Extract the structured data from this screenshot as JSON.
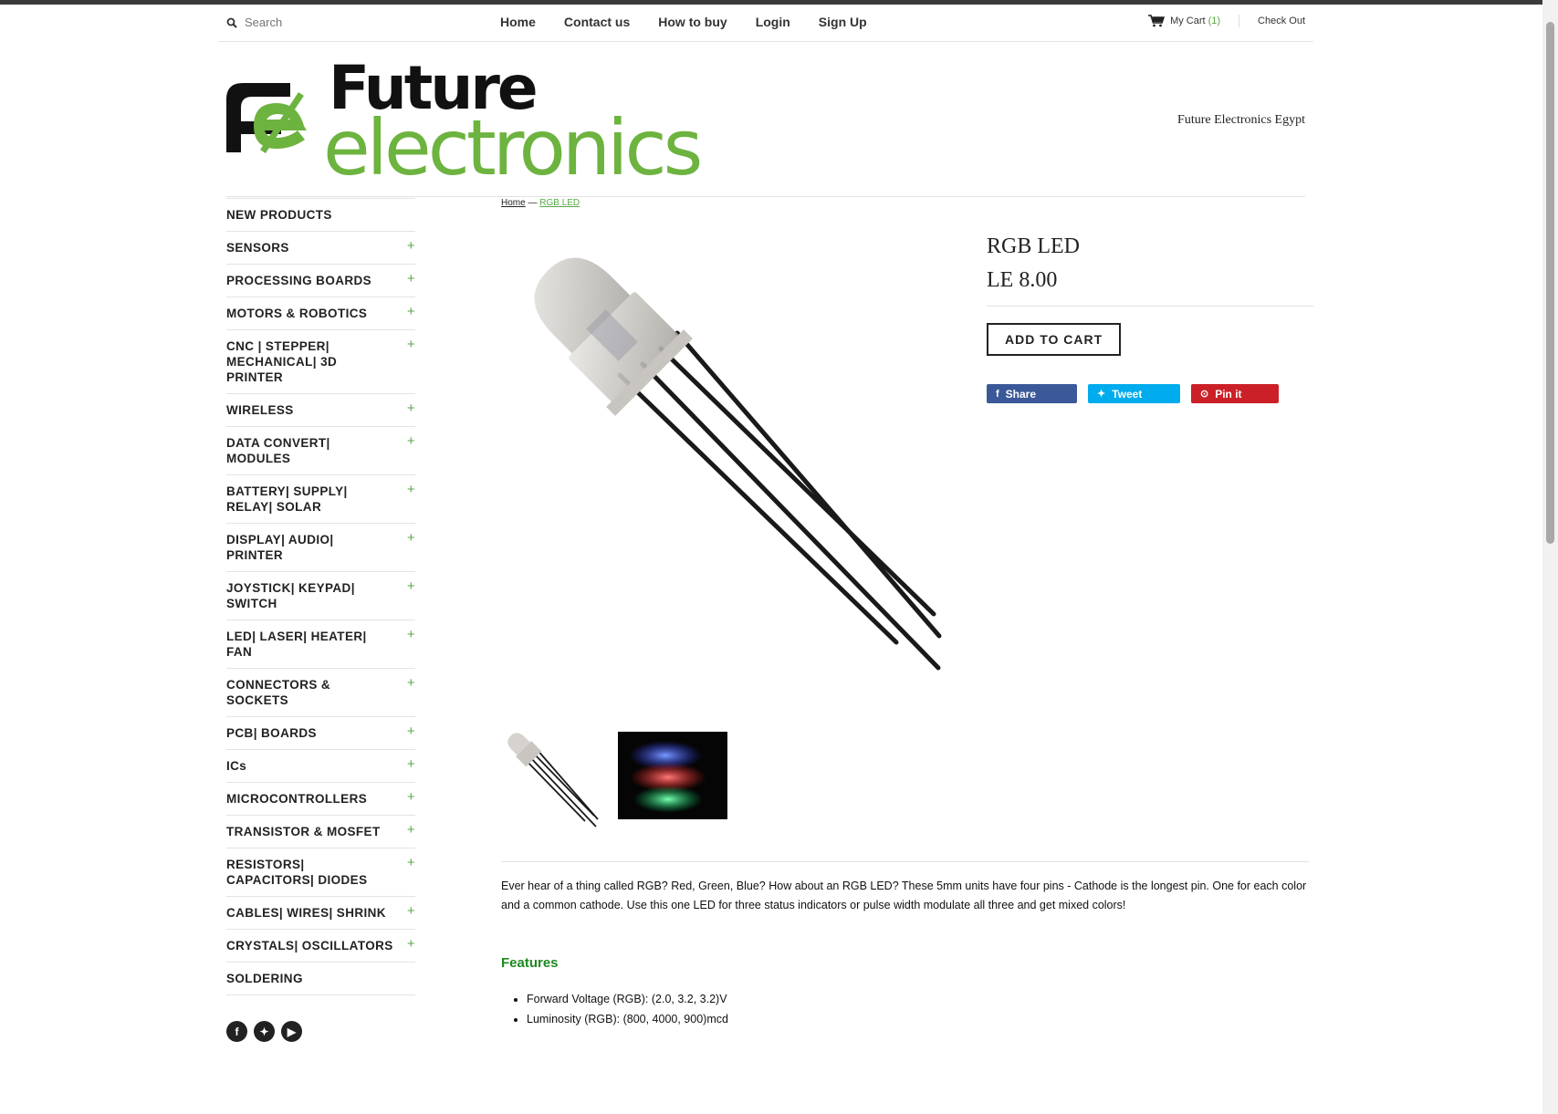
{
  "header": {
    "search_placeholder": "Search",
    "nav": [
      "Home",
      "Contact us",
      "How to buy",
      "Login",
      "Sign Up"
    ],
    "cart_label": "My Cart",
    "cart_count": "(1)",
    "checkout_label": "Check Out"
  },
  "brand": {
    "logo_mark": "FE",
    "logo_line1": "Future",
    "logo_line2": "electronics",
    "tagline": "Future Electronics Egypt",
    "green": "#6db33f",
    "black": "#111111"
  },
  "sidebar": {
    "items": [
      {
        "label": "NEW PRODUCTS",
        "expandable": false
      },
      {
        "label": "SENSORS",
        "expandable": true
      },
      {
        "label": "PROCESSING BOARDS",
        "expandable": true
      },
      {
        "label": "MOTORS & ROBOTICS",
        "expandable": true
      },
      {
        "label": "CNC | STEPPER| MECHANICAL| 3D PRINTER",
        "expandable": true
      },
      {
        "label": "WIRELESS",
        "expandable": true
      },
      {
        "label": "DATA CONVERT| MODULES",
        "expandable": true
      },
      {
        "label": "BATTERY| SUPPLY| RELAY| SOLAR",
        "expandable": true
      },
      {
        "label": "DISPLAY| AUDIO| PRINTER",
        "expandable": true
      },
      {
        "label": "JOYSTICK| KEYPAD| SWITCH",
        "expandable": true
      },
      {
        "label": "LED| LASER| HEATER| FAN",
        "expandable": true
      },
      {
        "label": "CONNECTORS & SOCKETS",
        "expandable": true
      },
      {
        "label": "PCB| BOARDS",
        "expandable": true
      },
      {
        "label": "ICs",
        "expandable": true
      },
      {
        "label": "MICROCONTROLLERS",
        "expandable": true
      },
      {
        "label": "TRANSISTOR & MOSFET",
        "expandable": true
      },
      {
        "label": "RESISTORS| CAPACITORS| DIODES",
        "expandable": true
      },
      {
        "label": "CABLES| WIRES| SHRINK",
        "expandable": true
      },
      {
        "label": "CRYSTALS| OSCILLATORS",
        "expandable": true
      },
      {
        "label": "SOLDERING",
        "expandable": false
      }
    ],
    "plus": "+",
    "socials": [
      "facebook-icon",
      "twitter-icon",
      "youtube-icon"
    ]
  },
  "breadcrumb": {
    "home": "Home",
    "sep": " — ",
    "current": "RGB LED"
  },
  "product": {
    "title": "RGB LED",
    "price": "LE 8.00",
    "add_to_cart": "ADD TO CART",
    "share": "Share",
    "tweet": "Tweet",
    "pin": "Pin it",
    "description": "Ever hear of a thing called RGB? Red, Green, Blue? How about an RGB LED? These 5mm units have four pins - Cathode is the longest pin. One for each color and a common cathode. Use this one LED for three status indicators or pulse width modulate all three and get mixed colors!",
    "features_heading": "Features",
    "features": [
      "Forward Voltage (RGB): (2.0, 3.2, 3.2)V",
      "Luminosity (RGB): (800, 4000, 900)mcd"
    ]
  }
}
